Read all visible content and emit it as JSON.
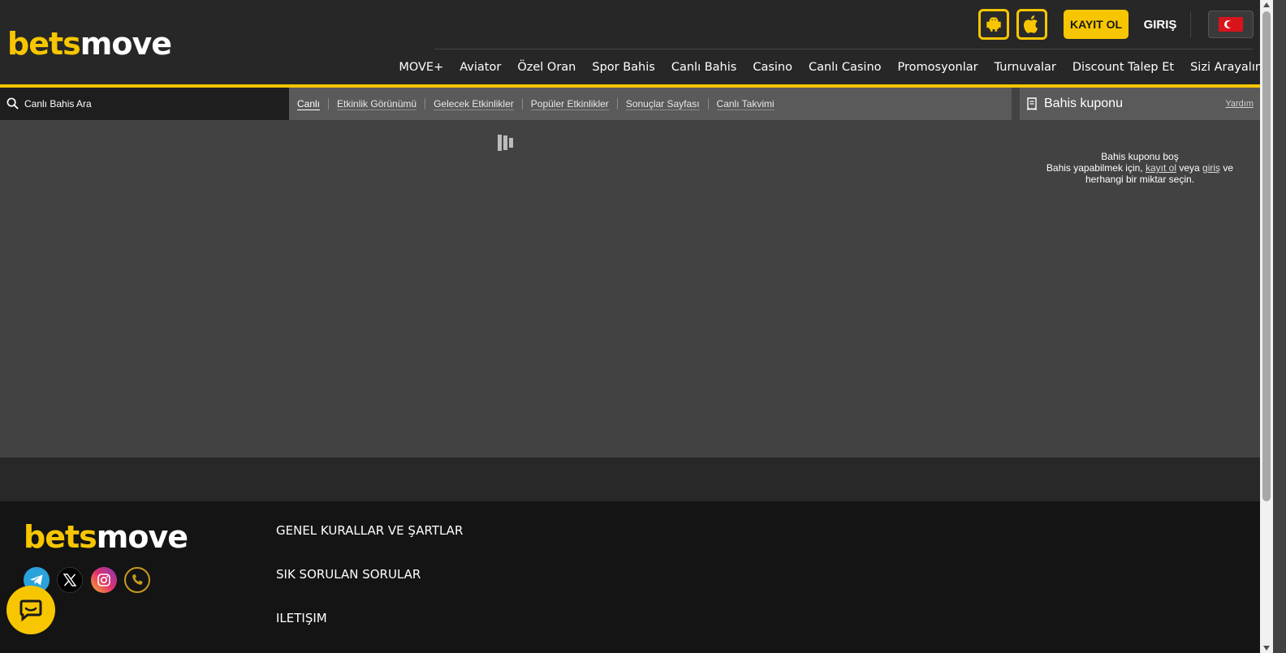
{
  "brand": {
    "part1": "bets",
    "part2": "move",
    "accent": "#f7c600"
  },
  "header": {
    "register_label": "KAYIT OL",
    "login_label": "GIRIŞ",
    "android_icon": "android-icon",
    "apple_icon": "apple-icon",
    "language_flag": "turkey-flag-icon"
  },
  "nav": {
    "items": [
      "MOVE+",
      "Aviator",
      "Özel Oran",
      "Spor Bahis",
      "Canlı Bahis",
      "Casino",
      "Canlı Casino",
      "Promosyonlar",
      "Turnuvalar",
      "Discount Talep Et",
      "Sizi Arayalım"
    ]
  },
  "search": {
    "placeholder": "Canlı Bahis Ara"
  },
  "subnav": {
    "items": [
      "Canlı",
      "Etkinlik Görünümü",
      "Gelecek Etkinlikler",
      "Popüler Etkinlikler",
      "Sonuçlar Sayfası",
      "Canlı Takvimi"
    ]
  },
  "betslip": {
    "title": "Bahis kuponu",
    "help": "Yardım",
    "empty_title": "Bahis kuponu boş",
    "empty_text_before": "Bahis yapabilmek için,",
    "register_link": "kayıt ol",
    "or_text": "veya",
    "login_link": "giriş",
    "and_text": "ve",
    "empty_text_after": "herhangi bir miktar seçin."
  },
  "footer": {
    "links": [
      "GENEL KURALLAR VE ŞARTLAR",
      "SIK SORULAN SORULAR",
      "ILETIŞIM"
    ],
    "social": [
      "telegram-icon",
      "x-icon",
      "instagram-icon",
      "phone-icon"
    ]
  }
}
